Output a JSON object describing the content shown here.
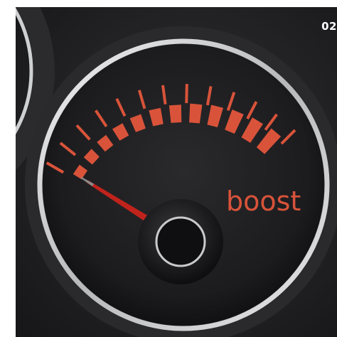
{
  "page_number": "02",
  "gauge": {
    "label": "boost",
    "needle_level": 0.02,
    "tick_count": 12,
    "colors": {
      "scale": "#d9533a",
      "needle": "#c0231c",
      "bezel": "#cfd0d2",
      "dial": "#1e1e20",
      "background": "#232325"
    }
  }
}
